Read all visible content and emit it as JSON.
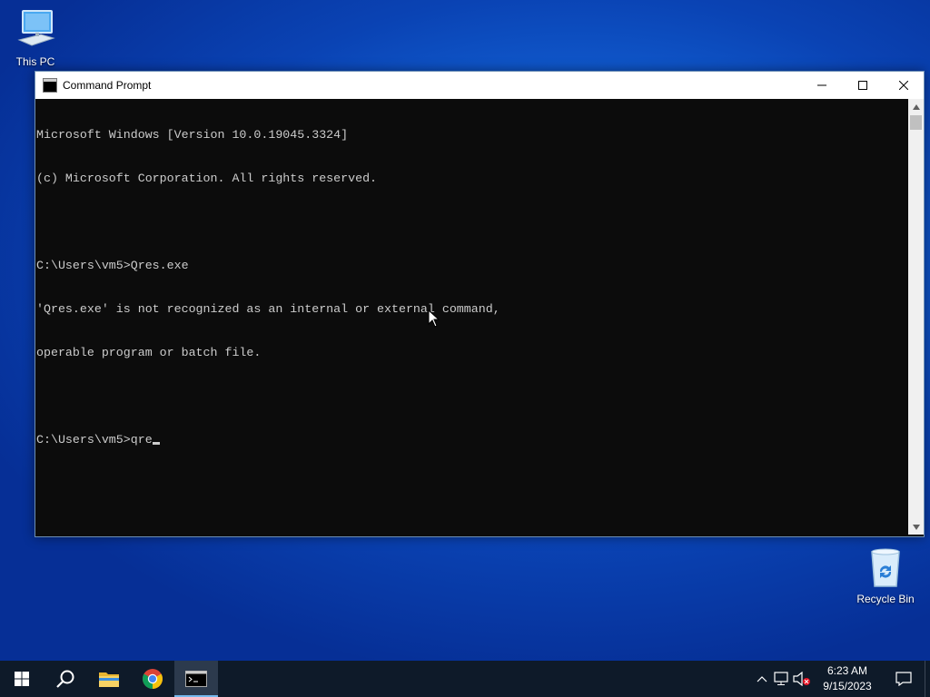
{
  "desktop": {
    "icons": [
      {
        "label": "This PC",
        "icon": "computer-icon"
      },
      {
        "label": "Recycle Bin",
        "icon": "recycle-bin-icon"
      }
    ]
  },
  "window": {
    "title": "Command Prompt",
    "icon": "cmd-icon",
    "controls": {
      "minimize": "minimize-icon",
      "maximize": "maximize-icon",
      "close": "close-icon"
    },
    "console_lines": [
      "Microsoft Windows [Version 10.0.19045.3324]",
      "(c) Microsoft Corporation. All rights reserved.",
      "",
      "C:\\Users\\vm5>Qres.exe",
      "'Qres.exe' is not recognized as an internal or external command,",
      "operable program or batch file.",
      "",
      "C:\\Users\\vm5>qre"
    ]
  },
  "taskbar": {
    "items": [
      {
        "name": "start",
        "icon": "windows-start-icon"
      },
      {
        "name": "search",
        "icon": "search-icon"
      },
      {
        "name": "file-explorer",
        "icon": "folder-icon"
      },
      {
        "name": "chrome",
        "icon": "chrome-icon"
      },
      {
        "name": "command-prompt",
        "icon": "cmd-icon",
        "active": true
      }
    ],
    "tray": {
      "icons": [
        "chevron-up-icon",
        "network-icon",
        "volume-muted-icon"
      ],
      "time": "6:23 AM",
      "date": "9/15/2023",
      "notification_icon": "notification-icon"
    }
  }
}
